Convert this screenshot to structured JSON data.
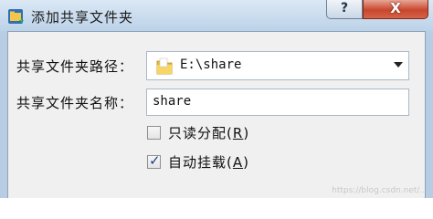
{
  "window": {
    "title": "添加共享文件夹",
    "help_label": "?",
    "close_label": "X"
  },
  "form": {
    "path_label": "共享文件夹路径：",
    "path_value": "E:\\share",
    "name_label": "共享文件夹名称：",
    "name_value": "share",
    "readonly": {
      "text": "只读分配",
      "mnemonic": "R",
      "checked": false
    },
    "automount": {
      "text": "自动挂载",
      "mnemonic": "A",
      "checked": true
    }
  },
  "icons": {
    "app": "virtualbox-folder-icon",
    "folder": "folder-icon"
  },
  "watermark": "https://blog.csdn.net/...",
  "colors": {
    "titlebar": "#c6d9ec",
    "close_button": "#c9462d",
    "client_bg": "#f0f0f0"
  }
}
